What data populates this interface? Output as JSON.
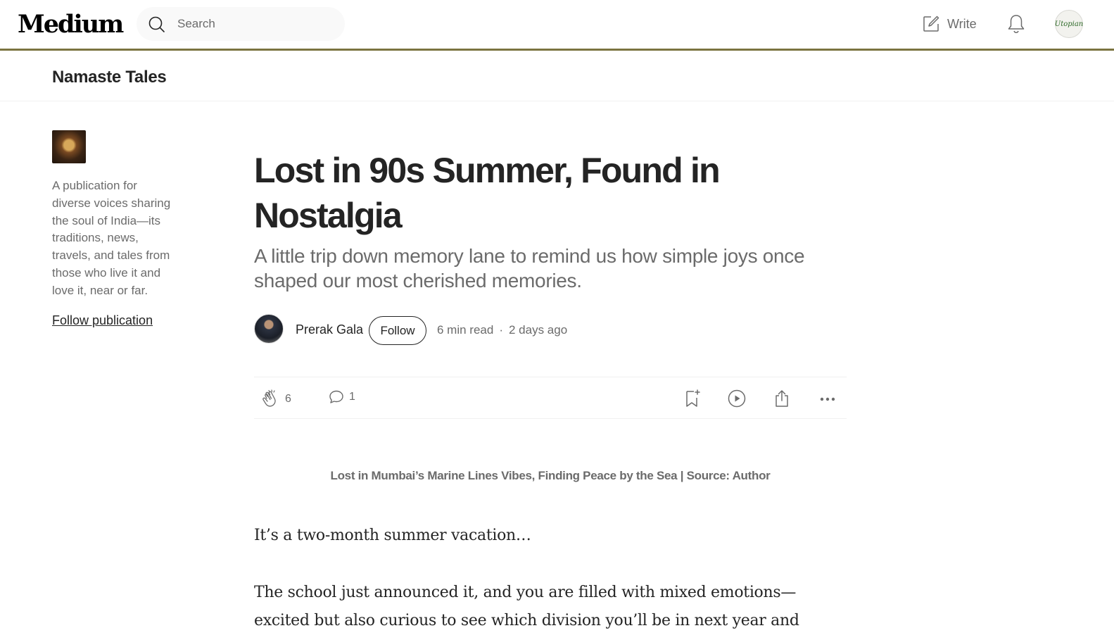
{
  "header": {
    "logo": "Medium",
    "search_placeholder": "Search",
    "write_label": "Write",
    "bell_icon": "bell-icon",
    "avatar_text": "Utopian"
  },
  "publication": {
    "name": "Namaste Tales",
    "description": "A publication for diverse voices sharing the soul of India—its traditions, news, travels, and tales from those who live it and love it, near or far.",
    "follow_label": "Follow publication"
  },
  "article": {
    "title": "Lost in 90s Summer, Found in Nostalgia",
    "subtitle": "A little trip down memory lane to remind us how simple joys once shaped our most cherished memories.",
    "author": "Prerak Gala",
    "follow_label": "Follow",
    "read_time": "6 min read",
    "separator": "·",
    "published": "2 days ago",
    "claps": "6",
    "responses": "1",
    "caption": "Lost in Mumbai’s Marine Lines Vibes, Finding Peace by the Sea | Source: Author",
    "paragraphs": [
      "It’s a two-month summer vacation…",
      "The school just announced it, and you are filled with mixed emotions— excited but also curious to see which division you’ll be in next year and"
    ]
  },
  "colors": {
    "header_rule": "#7b7440",
    "text": "#242424",
    "muted": "#6b6b6b"
  }
}
